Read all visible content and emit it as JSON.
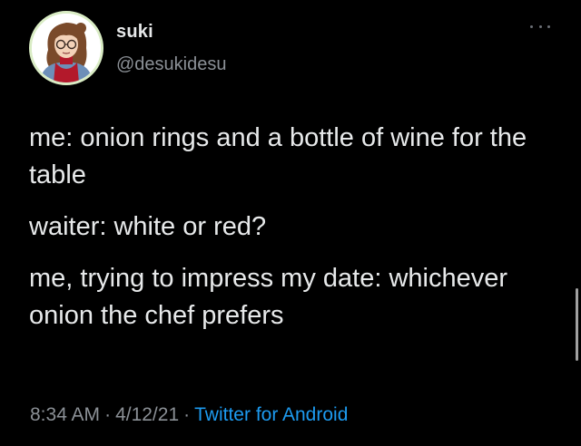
{
  "author": {
    "display_name": "suki",
    "handle": "@desukidesu",
    "avatar_icon": "avatar-illustration"
  },
  "tweet": {
    "paragraphs": [
      "me: onion rings and a bottle of wine for the table",
      "waiter: white or red?",
      "me, trying to impress my date: whichever onion the chef prefers"
    ],
    "time": "8:34 AM",
    "separator": "·",
    "date": "4/12/21",
    "source": "Twitter for Android"
  },
  "icons": {
    "more": "more-horizontal-icon"
  },
  "colors": {
    "background": "#000000",
    "text": "#e7e9ea",
    "secondary": "#8b9096",
    "link": "#1d9bf0"
  }
}
